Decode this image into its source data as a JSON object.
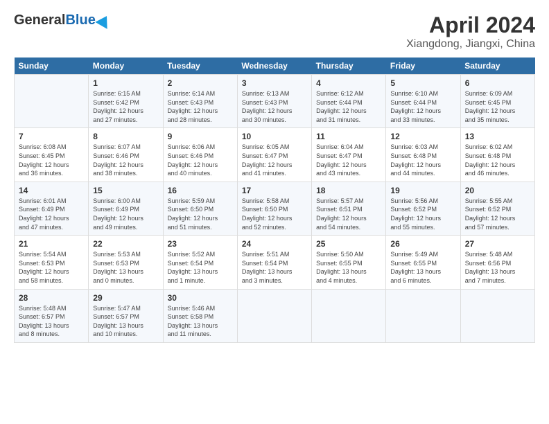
{
  "header": {
    "logo_general": "General",
    "logo_blue": "Blue",
    "title": "April 2024",
    "subtitle": "Xiangdong, Jiangxi, China"
  },
  "weekdays": [
    "Sunday",
    "Monday",
    "Tuesday",
    "Wednesday",
    "Thursday",
    "Friday",
    "Saturday"
  ],
  "weeks": [
    [
      {
        "day": "",
        "info": ""
      },
      {
        "day": "1",
        "info": "Sunrise: 6:15 AM\nSunset: 6:42 PM\nDaylight: 12 hours\nand 27 minutes."
      },
      {
        "day": "2",
        "info": "Sunrise: 6:14 AM\nSunset: 6:43 PM\nDaylight: 12 hours\nand 28 minutes."
      },
      {
        "day": "3",
        "info": "Sunrise: 6:13 AM\nSunset: 6:43 PM\nDaylight: 12 hours\nand 30 minutes."
      },
      {
        "day": "4",
        "info": "Sunrise: 6:12 AM\nSunset: 6:44 PM\nDaylight: 12 hours\nand 31 minutes."
      },
      {
        "day": "5",
        "info": "Sunrise: 6:10 AM\nSunset: 6:44 PM\nDaylight: 12 hours\nand 33 minutes."
      },
      {
        "day": "6",
        "info": "Sunrise: 6:09 AM\nSunset: 6:45 PM\nDaylight: 12 hours\nand 35 minutes."
      }
    ],
    [
      {
        "day": "7",
        "info": "Sunrise: 6:08 AM\nSunset: 6:45 PM\nDaylight: 12 hours\nand 36 minutes."
      },
      {
        "day": "8",
        "info": "Sunrise: 6:07 AM\nSunset: 6:46 PM\nDaylight: 12 hours\nand 38 minutes."
      },
      {
        "day": "9",
        "info": "Sunrise: 6:06 AM\nSunset: 6:46 PM\nDaylight: 12 hours\nand 40 minutes."
      },
      {
        "day": "10",
        "info": "Sunrise: 6:05 AM\nSunset: 6:47 PM\nDaylight: 12 hours\nand 41 minutes."
      },
      {
        "day": "11",
        "info": "Sunrise: 6:04 AM\nSunset: 6:47 PM\nDaylight: 12 hours\nand 43 minutes."
      },
      {
        "day": "12",
        "info": "Sunrise: 6:03 AM\nSunset: 6:48 PM\nDaylight: 12 hours\nand 44 minutes."
      },
      {
        "day": "13",
        "info": "Sunrise: 6:02 AM\nSunset: 6:48 PM\nDaylight: 12 hours\nand 46 minutes."
      }
    ],
    [
      {
        "day": "14",
        "info": "Sunrise: 6:01 AM\nSunset: 6:49 PM\nDaylight: 12 hours\nand 47 minutes."
      },
      {
        "day": "15",
        "info": "Sunrise: 6:00 AM\nSunset: 6:49 PM\nDaylight: 12 hours\nand 49 minutes."
      },
      {
        "day": "16",
        "info": "Sunrise: 5:59 AM\nSunset: 6:50 PM\nDaylight: 12 hours\nand 51 minutes."
      },
      {
        "day": "17",
        "info": "Sunrise: 5:58 AM\nSunset: 6:50 PM\nDaylight: 12 hours\nand 52 minutes."
      },
      {
        "day": "18",
        "info": "Sunrise: 5:57 AM\nSunset: 6:51 PM\nDaylight: 12 hours\nand 54 minutes."
      },
      {
        "day": "19",
        "info": "Sunrise: 5:56 AM\nSunset: 6:52 PM\nDaylight: 12 hours\nand 55 minutes."
      },
      {
        "day": "20",
        "info": "Sunrise: 5:55 AM\nSunset: 6:52 PM\nDaylight: 12 hours\nand 57 minutes."
      }
    ],
    [
      {
        "day": "21",
        "info": "Sunrise: 5:54 AM\nSunset: 6:53 PM\nDaylight: 12 hours\nand 58 minutes."
      },
      {
        "day": "22",
        "info": "Sunrise: 5:53 AM\nSunset: 6:53 PM\nDaylight: 13 hours\nand 0 minutes."
      },
      {
        "day": "23",
        "info": "Sunrise: 5:52 AM\nSunset: 6:54 PM\nDaylight: 13 hours\nand 1 minute."
      },
      {
        "day": "24",
        "info": "Sunrise: 5:51 AM\nSunset: 6:54 PM\nDaylight: 13 hours\nand 3 minutes."
      },
      {
        "day": "25",
        "info": "Sunrise: 5:50 AM\nSunset: 6:55 PM\nDaylight: 13 hours\nand 4 minutes."
      },
      {
        "day": "26",
        "info": "Sunrise: 5:49 AM\nSunset: 6:55 PM\nDaylight: 13 hours\nand 6 minutes."
      },
      {
        "day": "27",
        "info": "Sunrise: 5:48 AM\nSunset: 6:56 PM\nDaylight: 13 hours\nand 7 minutes."
      }
    ],
    [
      {
        "day": "28",
        "info": "Sunrise: 5:48 AM\nSunset: 6:57 PM\nDaylight: 13 hours\nand 8 minutes."
      },
      {
        "day": "29",
        "info": "Sunrise: 5:47 AM\nSunset: 6:57 PM\nDaylight: 13 hours\nand 10 minutes."
      },
      {
        "day": "30",
        "info": "Sunrise: 5:46 AM\nSunset: 6:58 PM\nDaylight: 13 hours\nand 11 minutes."
      },
      {
        "day": "",
        "info": ""
      },
      {
        "day": "",
        "info": ""
      },
      {
        "day": "",
        "info": ""
      },
      {
        "day": "",
        "info": ""
      }
    ]
  ]
}
